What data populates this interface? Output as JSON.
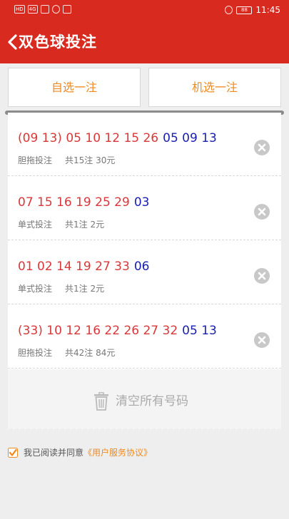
{
  "status_bar": {
    "network_1": "HD",
    "network_2": "4G",
    "battery": "88",
    "time": "11:45"
  },
  "header": {
    "title": "双色球投注"
  },
  "actions": {
    "manual_label": "自选一注",
    "random_label": "机选一注"
  },
  "entries": [
    {
      "red": "(09 13) 05 10 12 15 26",
      "blue": "05 09 13",
      "type": "胆拖投注",
      "summary": "共15注 30元"
    },
    {
      "red": "07 15 16 19 25 29",
      "blue": "03",
      "type": "单式投注",
      "summary": "共1注 2元"
    },
    {
      "red": "01 02 14 19 27 33",
      "blue": "06",
      "type": "单式投注",
      "summary": "共1注 2元"
    },
    {
      "red": "(33) 10 12 16 22 26 27 32",
      "blue": "05 13",
      "type": "胆拖投注",
      "summary": "共42注 84元"
    }
  ],
  "clear": {
    "label": "清空所有号码"
  },
  "agreement": {
    "text": "我已阅读并同意",
    "link": "《用户服务协议》",
    "checked": true
  },
  "colors": {
    "brand_red": "#d92a20",
    "accent_orange": "#f08a1e",
    "red_ball": "#d9383a",
    "blue_ball": "#1a20b0"
  },
  "icons": [
    "back-arrow-icon",
    "delete-circle-icon",
    "trash-icon",
    "checkbox-checked-icon"
  ]
}
